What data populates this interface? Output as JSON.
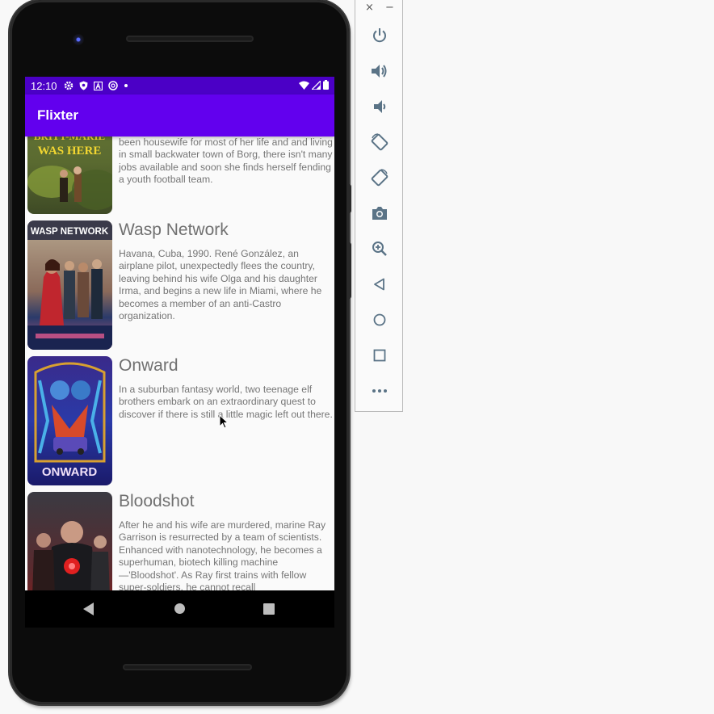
{
  "status_bar": {
    "time": "12:10",
    "icons_left": [
      "gear-icon",
      "shield-icon",
      "a-icon",
      "sync-icon",
      "dot-icon"
    ],
    "icons_right": [
      "wifi-icon",
      "signal-icon",
      "battery-icon"
    ],
    "color": "#4b00c6"
  },
  "app_bar": {
    "title": "Flixter",
    "color": "#6200ee"
  },
  "movies": [
    {
      "title": "",
      "poster_text": "BRITT-MARIE WAS HERE",
      "description": "been housewife for most of her life and and living in small backwater town of Borg, there isn't many jobs available and soon she finds herself fending a youth football team."
    },
    {
      "title": "Wasp Network",
      "poster_text": "WASP NETWORK",
      "description": "Havana, Cuba, 1990. René González, an airplane pilot, unexpectedly flees the country, leaving behind his wife Olga and his daughter Irma, and begins a new life in Miami, where he becomes a member of an anti-Castro organization."
    },
    {
      "title": "Onward",
      "poster_text": "ONWARD",
      "description": "In a suburban fantasy world, two teenage elf brothers embark on an extraordinary quest to discover if there is still a little magic left out there."
    },
    {
      "title": "Bloodshot",
      "poster_text": "",
      "description": "After he and his wife are murdered, marine Ray Garrison is resurrected by a team of scientists. Enhanced with nanotechnology, he becomes a superhuman, biotech killing machine—'Bloodshot'. As Ray first trains with fellow super-soldiers, he cannot recall"
    }
  ],
  "nav_bar": {
    "buttons": [
      "back-icon",
      "home-icon",
      "recents-icon"
    ]
  },
  "emulator_toolbar": {
    "window_controls": [
      "×",
      "−"
    ],
    "buttons": [
      "power-icon",
      "volume-up-icon",
      "volume-down-icon",
      "rotate-left-icon",
      "rotate-right-icon",
      "camera-icon",
      "zoom-icon",
      "back-icon",
      "home-icon",
      "overview-icon",
      "more-icon"
    ]
  }
}
